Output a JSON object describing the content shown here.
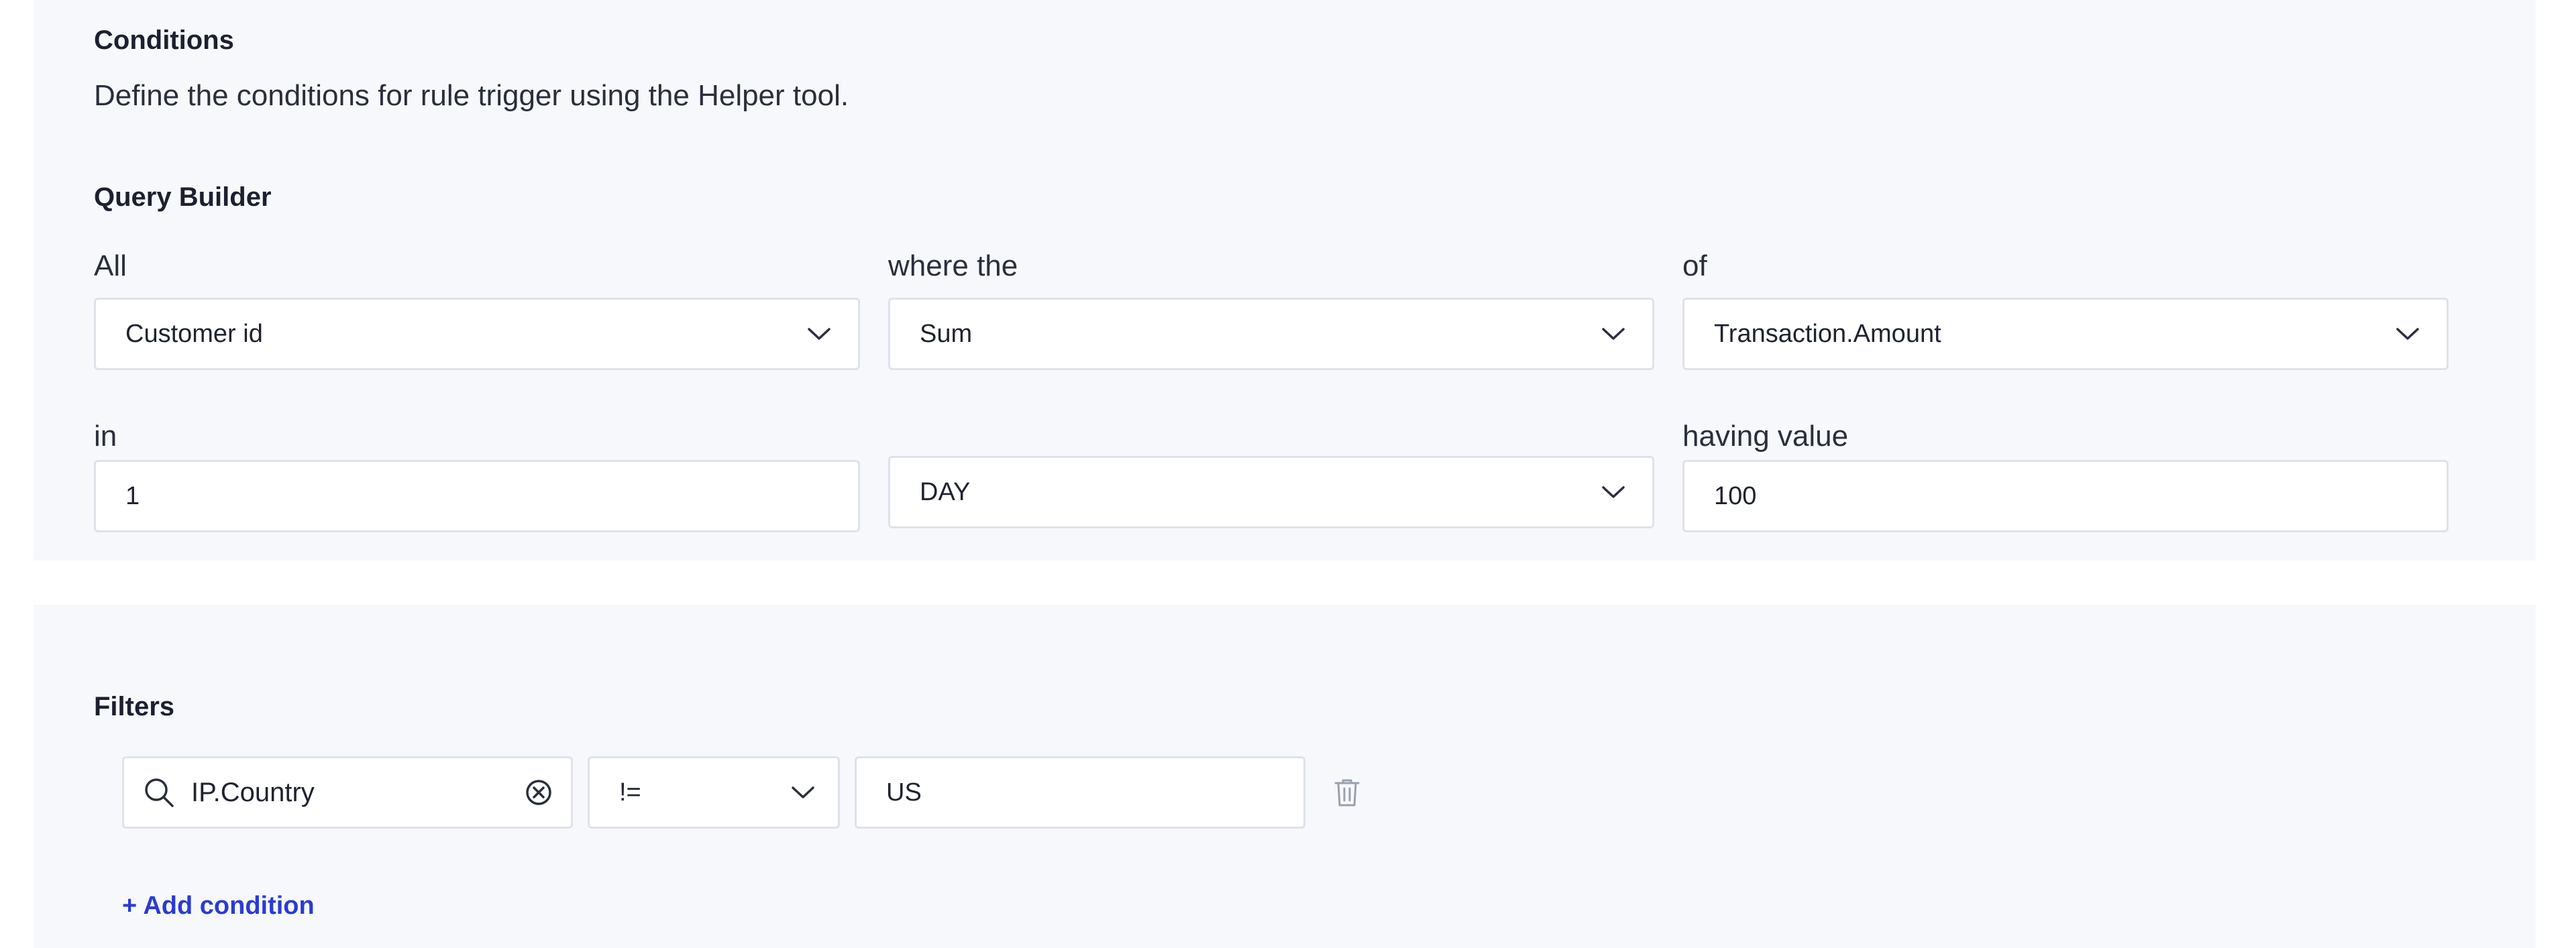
{
  "conditions": {
    "title": "Conditions",
    "description": "Define the conditions for rule trigger using the Helper tool."
  },
  "query_builder": {
    "title": "Query Builder",
    "all_label": "All",
    "group_by_value": "Customer id",
    "where_label": "where the",
    "aggregation_value": "Sum",
    "of_label": "of",
    "field_value": "Transaction.Amount",
    "in_label": "in",
    "period_value": "1",
    "period_unit_value": "DAY",
    "having_label": "having value",
    "having_value": "100"
  },
  "filters": {
    "title": "Filters",
    "items": [
      {
        "field": "IP.Country",
        "operator": "!=",
        "value": "US"
      }
    ],
    "add_condition_label": "+ Add condition"
  },
  "colors": {
    "panel_background": "#f7f8fc",
    "border": "#dfe2ea",
    "link": "#2a3bd4"
  }
}
